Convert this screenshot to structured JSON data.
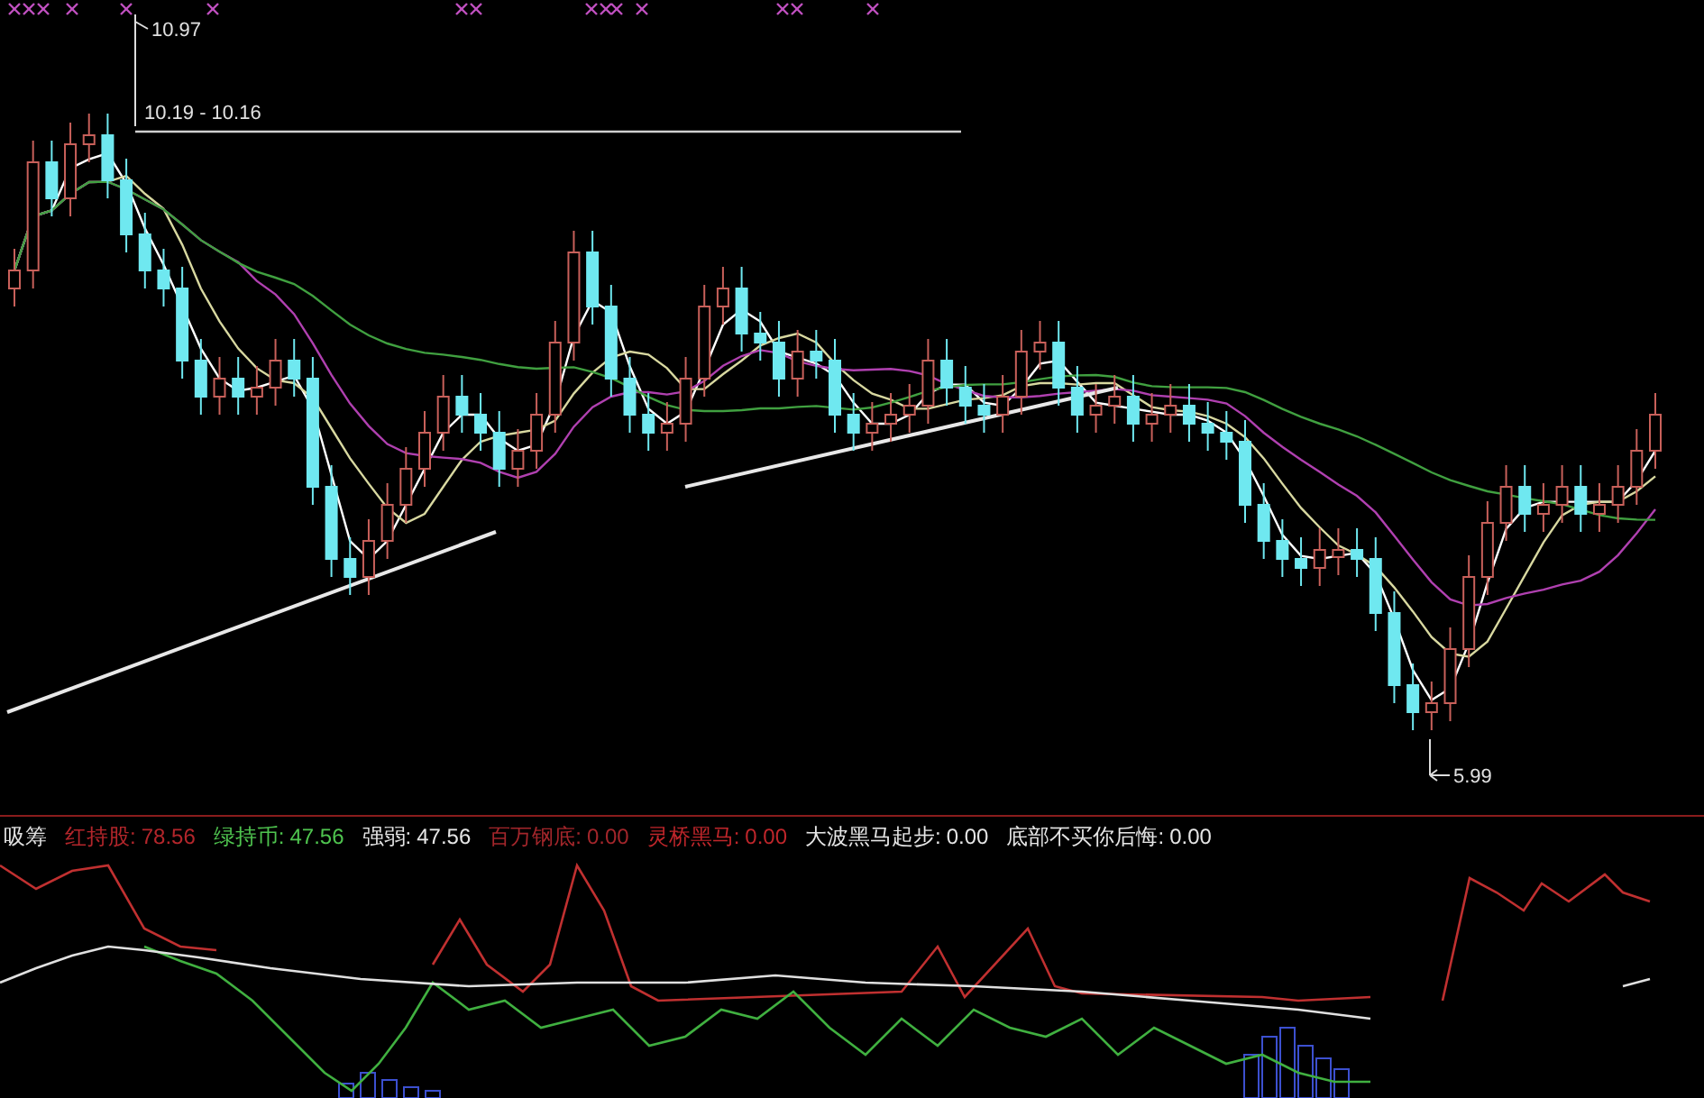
{
  "price_chart": {
    "annotations": [
      {
        "text": "10.97"
      },
      {
        "text": "10.19 - 10.16"
      },
      {
        "text": "5.99"
      }
    ]
  },
  "indicator_bar": {
    "items": [
      {
        "kind": "title",
        "label": "吸筹",
        "color": "#e0e0e0"
      },
      {
        "kind": "reading",
        "label": "红持股:",
        "value": "78.56",
        "color": "#b3262b"
      },
      {
        "kind": "reading",
        "label": "绿持币:",
        "value": "47.56",
        "color": "#4fc44f"
      },
      {
        "kind": "reading",
        "label": "强弱:",
        "value": "47.56",
        "color": "#e6e6e6"
      },
      {
        "kind": "reading",
        "label": "百万钢底:",
        "value": "0.00",
        "color": "#a3262b"
      },
      {
        "kind": "reading",
        "label": "灵桥黑马:",
        "value": "0.00",
        "color": "#c0262b"
      },
      {
        "kind": "reading",
        "label": "大波黑马起步:",
        "value": "0.00",
        "color": "#e6e6e6"
      },
      {
        "kind": "reading",
        "label": "底部不买你后悔:",
        "value": "0.00",
        "color": "#e6e6e6"
      }
    ]
  }
}
